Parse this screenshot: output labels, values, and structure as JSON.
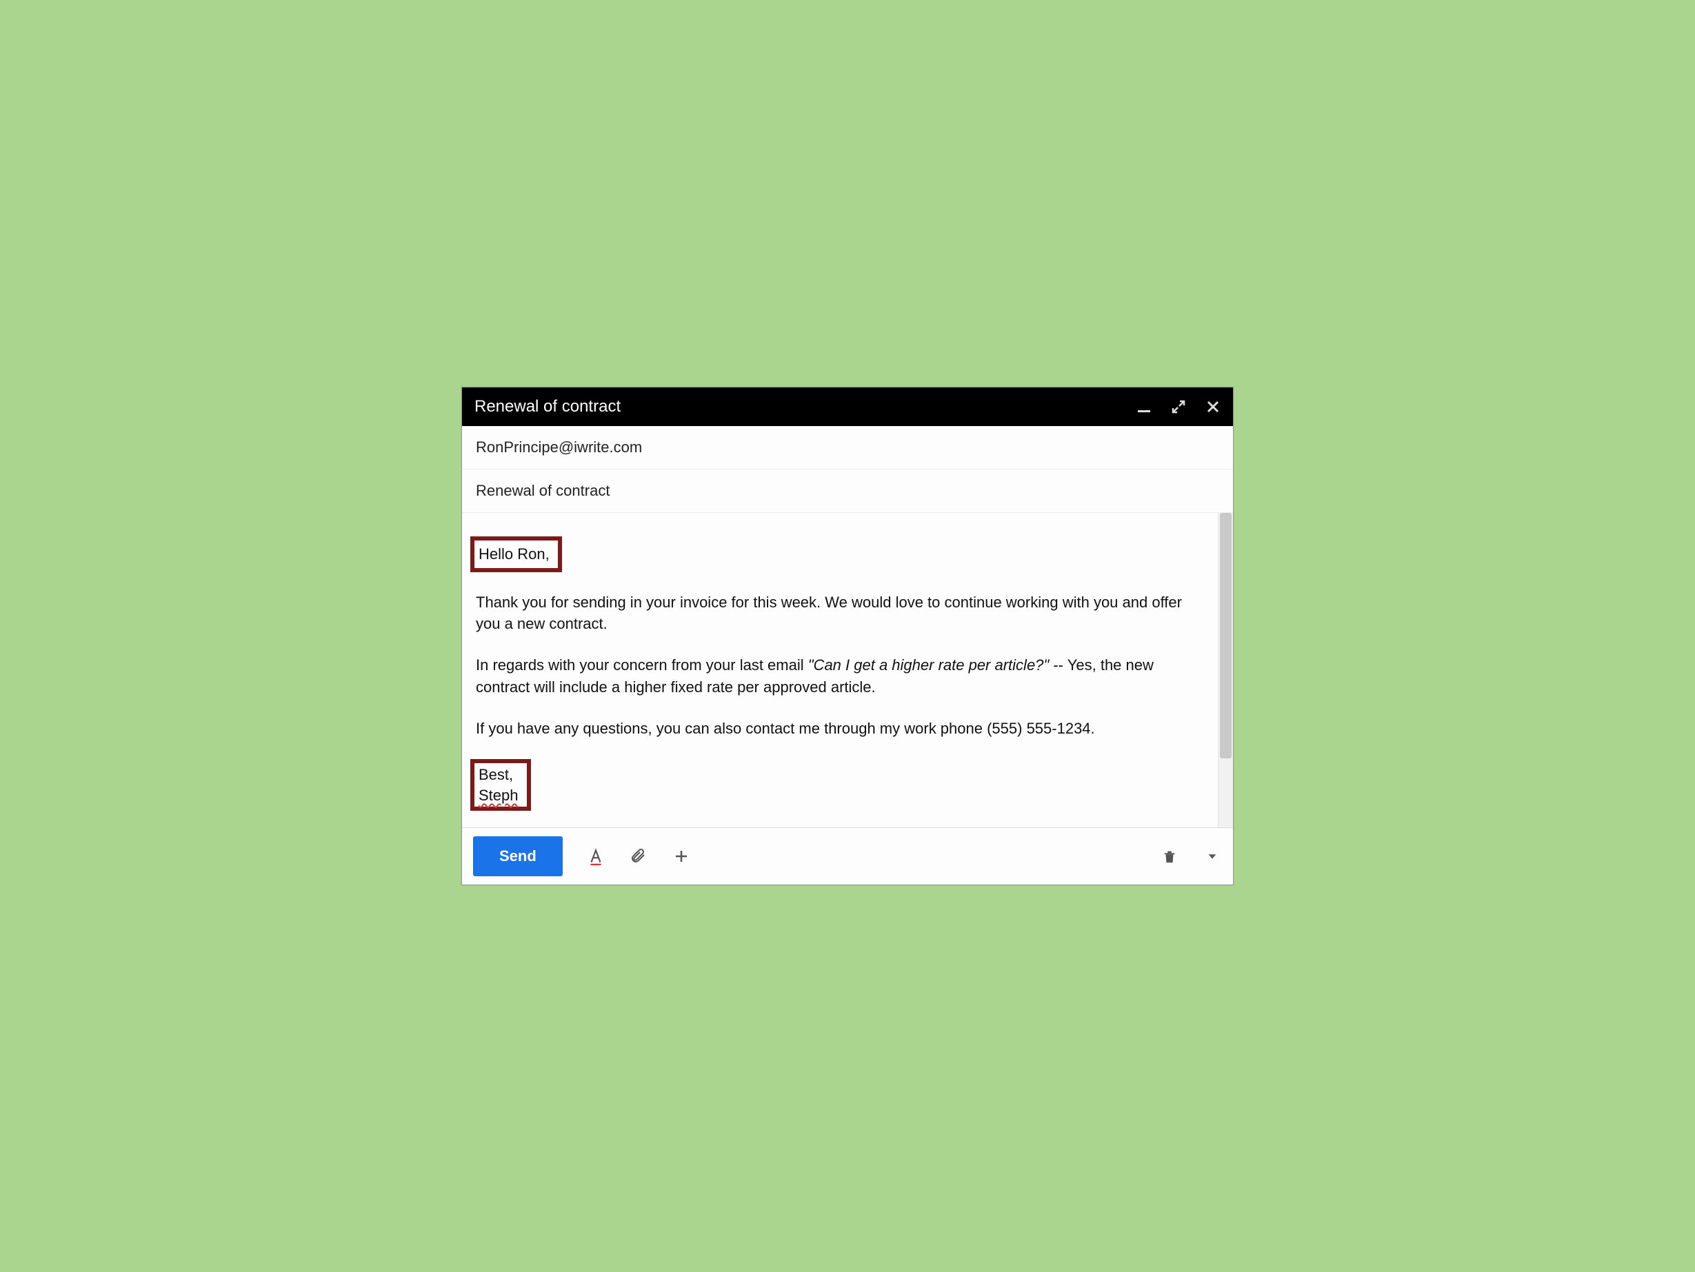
{
  "titlebar": {
    "title": "Renewal of contract"
  },
  "fields": {
    "to": "RonPrincipe@iwrite.com",
    "subject": "Renewal of contract"
  },
  "body": {
    "greeting": "Hello Ron,",
    "para1": "Thank you for sending in your invoice for this week. We would love to continue working with you and offer you a new contract.",
    "para2_pre": "In regards with your concern from your last email ",
    "para2_quote": "\"Can I get a higher rate per article?\"",
    "para2_post": " -- Yes, the new contract will include a higher fixed rate per approved article.",
    "para3": "If you have any questions, you can also contact me through my work phone (555) 555-1234.",
    "signoff": "Best,",
    "signature": "Steph"
  },
  "toolbar": {
    "send_label": "Send"
  }
}
